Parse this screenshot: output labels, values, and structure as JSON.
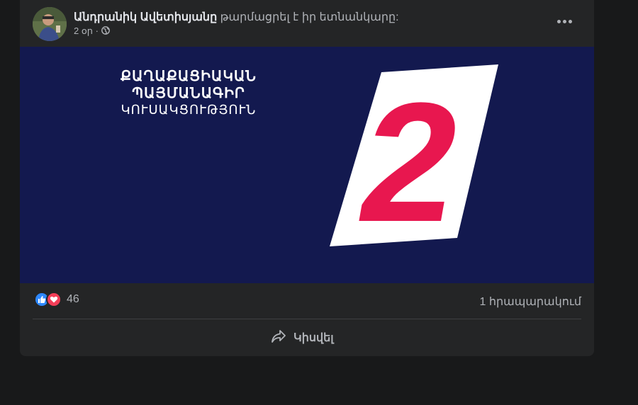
{
  "post": {
    "author": "Անդրանիկ Ավետիսյանը",
    "action": " թարմացրել է իր ետնանկարը:",
    "time": "2 օր ·",
    "poster": {
      "line1": "ՔԱՂԱՔԱՑԻԱԿԱՆ",
      "line2": "ՊԱՅՄԱՆԱԳԻՐ",
      "line3": "ԿՈՒՍԱԿՑՈՒԹՅՈՒՆ",
      "number": "2"
    },
    "reactions": {
      "count": "46",
      "shares": "1 հրապարակում"
    },
    "share_label": "Կիսվել"
  },
  "colors": {
    "background": "#18191a",
    "card": "#242526",
    "poster_bg": "#13194f",
    "accent_red": "#e8174f",
    "like_blue": "#2d88ff",
    "love_red": "#f33e58"
  }
}
